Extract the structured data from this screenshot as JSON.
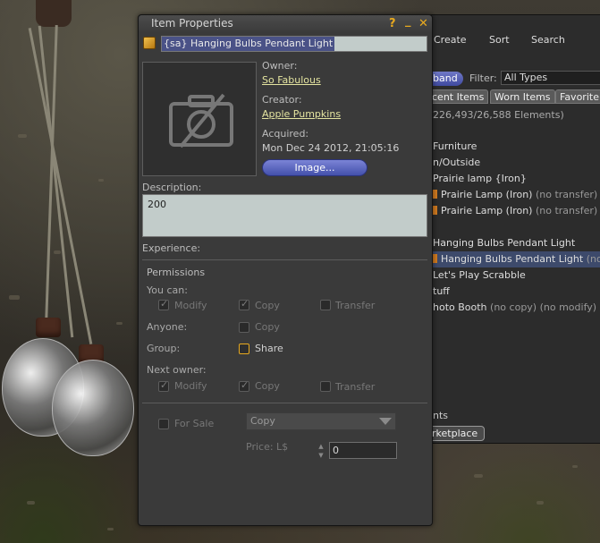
{
  "dialog": {
    "title": "Item Properties",
    "help_label": "?",
    "minimize_label": "_",
    "close_label": "✕",
    "item_name": "{sa} Hanging Bulbs Pendant Light",
    "owner_label": "Owner:",
    "owner": "So Fabulous",
    "creator_label": "Creator:",
    "creator": "Apple Pumpkins",
    "acquired_label": "Acquired:",
    "acquired": "Mon Dec 24 2012, 21:05:16",
    "image_button": "Image...",
    "description_label": "Description:",
    "description": "200",
    "experience_label": "Experience:",
    "permissions_label": "Permissions",
    "you_can_label": "You can:",
    "anyone_label": "Anyone:",
    "group_label": "Group:",
    "next_owner_label": "Next owner:",
    "perm_modify": "Modify",
    "perm_copy": "Copy",
    "perm_transfer": "Transfer",
    "perm_share": "Share",
    "for_sale_label": "For Sale",
    "sale_type": "Copy",
    "price_label": "Price: L$",
    "price_value": "0"
  },
  "permissions": {
    "you_can": {
      "modify": true,
      "copy": true,
      "transfer": false
    },
    "anyone": {
      "copy": false
    },
    "group": {
      "share": false
    },
    "next_owner": {
      "modify": true,
      "copy": true,
      "transfer": false
    },
    "for_sale": false
  },
  "inventory": {
    "menu": [
      "Create",
      "Sort",
      "Search"
    ],
    "expand_label": "band",
    "filter_label": "Filter:",
    "filter_value": "All Types",
    "tabs": [
      "cent Items",
      "Worn Items",
      "Favorite"
    ],
    "count": "226,493/26,588 Elements)",
    "rows": [
      {
        "text": "Furniture",
        "dim": ""
      },
      {
        "text": "n/Outside",
        "dim": ""
      },
      {
        "text": "Prairie lamp {Iron}",
        "dim": ""
      },
      {
        "text": "Prairie Lamp (Iron)",
        "dim": "(no transfer)"
      },
      {
        "text": "Prairie Lamp (Iron)",
        "dim": "(no transfer)"
      },
      {
        "text": "",
        "dim": ""
      },
      {
        "text": "Hanging Bulbs Pendant Light",
        "dim": ""
      },
      {
        "text": "Hanging Bulbs Pendant Light",
        "dim": "(no"
      },
      {
        "text": "Let's Play Scrabble",
        "dim": ""
      },
      {
        "text": "tuff",
        "dim": ""
      },
      {
        "text": "hoto Booth",
        "dim": "(no copy) (no modify)"
      }
    ],
    "bottom_tab": "nts",
    "marketplace": "rketplace"
  },
  "colors": {
    "accent": "#e8a91f",
    "button_blue": "#5a64c0",
    "link": "#e4e4a0"
  }
}
